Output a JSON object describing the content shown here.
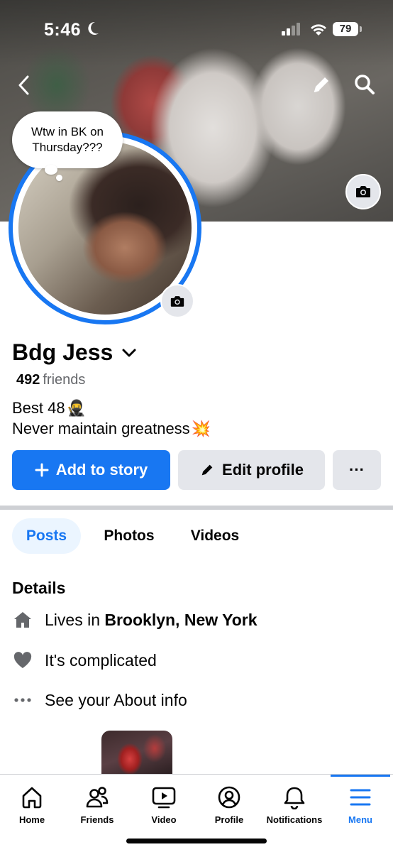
{
  "status_bar": {
    "time": "5:46",
    "battery": "79"
  },
  "profile": {
    "note": "Wtw in BK on Thursday???",
    "name": "Bdg Jess",
    "friends_count": "492",
    "friends_label": "friends",
    "bio_line1": "Best 48",
    "bio_line1_emoji": "🥷",
    "bio_line2": "Never maintain greatness",
    "bio_line2_emoji": "💥"
  },
  "actions": {
    "add_story": "Add to story",
    "edit_profile": "Edit profile",
    "more": "···"
  },
  "tabs": [
    {
      "label": "Posts",
      "active": true
    },
    {
      "label": "Photos",
      "active": false
    },
    {
      "label": "Videos",
      "active": false
    }
  ],
  "details": {
    "title": "Details",
    "lives_prefix": "Lives in",
    "lives_location": "Brooklyn, New York",
    "relationship": "It's complicated",
    "about": "See your About info"
  },
  "bottom_nav": [
    {
      "label": "Home",
      "icon": "home-icon"
    },
    {
      "label": "Friends",
      "icon": "friends-icon"
    },
    {
      "label": "Video",
      "icon": "video-icon"
    },
    {
      "label": "Profile",
      "icon": "profile-icon"
    },
    {
      "label": "Notifications",
      "icon": "bell-icon"
    },
    {
      "label": "Menu",
      "icon": "menu-icon",
      "active": true
    }
  ],
  "colors": {
    "accent": "#1877f2",
    "button_gray": "#e4e6eb",
    "text": "#050505",
    "secondary_text": "#65676b"
  }
}
